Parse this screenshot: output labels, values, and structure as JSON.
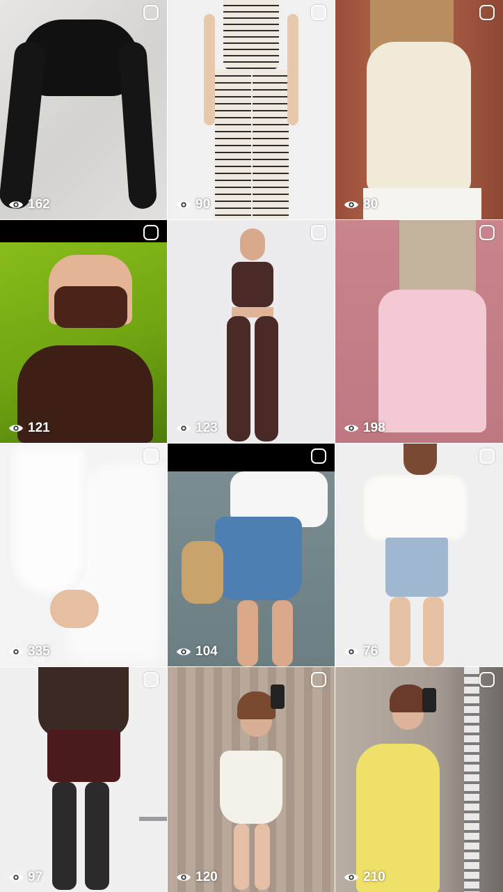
{
  "grid": {
    "posts": [
      {
        "views": "162"
      },
      {
        "views": "90"
      },
      {
        "views": "80"
      },
      {
        "views": "121"
      },
      {
        "views": "123"
      },
      {
        "views": "198"
      },
      {
        "views": "335"
      },
      {
        "views": "104"
      },
      {
        "views": "76"
      },
      {
        "views": "97"
      },
      {
        "views": "120"
      },
      {
        "views": "210"
      }
    ]
  },
  "icons": {
    "select": "select-checkbox-icon",
    "views": "eye-icon"
  },
  "colors": {
    "overlay_text": "#ffffff",
    "grid_gap": "#ffffff"
  }
}
